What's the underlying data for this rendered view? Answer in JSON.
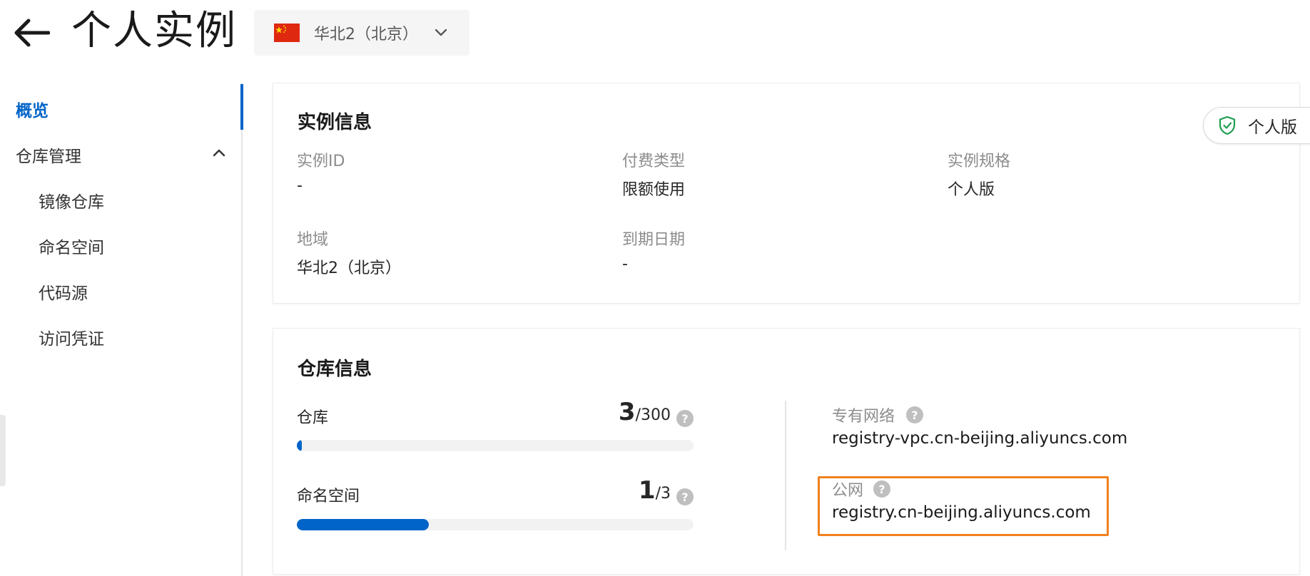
{
  "header": {
    "title": "个人实例",
    "region": "华北2（北京）",
    "colors": {
      "flag_red": "#de2910",
      "flag_yellow": "#ffde00"
    }
  },
  "sidebar": {
    "items": [
      {
        "label": "概览",
        "active": true
      },
      {
        "label": "仓库管理",
        "expanded": true
      },
      {
        "label": "镜像仓库"
      },
      {
        "label": "命名空间"
      },
      {
        "label": "代码源"
      },
      {
        "label": "访问凭证"
      }
    ]
  },
  "instance_info": {
    "title": "实例信息",
    "badge": "个人版",
    "fields": {
      "instance_id": {
        "label": "实例ID",
        "value": "-"
      },
      "billing_type": {
        "label": "付费类型",
        "value": "限额使用"
      },
      "spec": {
        "label": "实例规格",
        "value": "个人版"
      },
      "region": {
        "label": "地域",
        "value": "华北2（北京）"
      },
      "expiry": {
        "label": "到期日期",
        "value": "-"
      }
    }
  },
  "repo_info": {
    "title": "仓库信息",
    "quotas": [
      {
        "label": "仓库",
        "used": "3",
        "total": "/300",
        "fraction": 0.01
      },
      {
        "label": "命名空间",
        "used": "1",
        "total": "/3",
        "fraction": 0.333
      }
    ],
    "endpoints": {
      "vpc": {
        "label": "专有网络",
        "value": "registry-vpc.cn-beijing.aliyuncs.com"
      },
      "public": {
        "label": "公网",
        "value": "registry.cn-beijing.aliyuncs.com"
      }
    },
    "help_glyph": "?"
  },
  "colors": {
    "accent": "#0064c8",
    "highlight": "#f0811f",
    "badge_shield": "#1e9e50"
  }
}
